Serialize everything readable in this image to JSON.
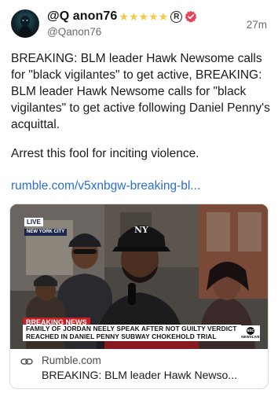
{
  "header": {
    "display_name": "@Q anon76",
    "star_count": 5,
    "handle": "@Qanon76",
    "time_ago": "27m"
  },
  "post": {
    "text_line_block": "BREAKING: BLM leader Hawk Newsome calls for \"black vigilantes\" to get active, BREAKING: BLM leader Hawk Newsome calls for \"black vigilantes\" to get active following Daniel Penny's acquittal.",
    "second_paragraph": "Arrest this fool for inciting violence.",
    "link_text": "rumble.com/v5xnbgw-breaking-bl..."
  },
  "card": {
    "domain": "Rumble.com",
    "title": "BREAKING: BLM leader Hawk Newso...",
    "thumbnail": {
      "live_label": "LIVE",
      "live_city": "NEW YORK CITY",
      "breaking_label": "BREAKING NEWS",
      "lower_third": "FAMILY OF JORDAN NEELY SPEAK AFTER NOT GUILTY VERDICT REACHED IN DANIEL PENNY SUBWAY CHOKEHOLD TRIAL",
      "network_tag": "NEWSLIVE",
      "network_mark": "abc"
    }
  },
  "colors": {
    "link": "#2a6fc9",
    "star": "#f2c94c",
    "verified": "#e8435a",
    "breaking": "#c81f25"
  },
  "icons": {
    "verified": "verified-badge-icon",
    "registered": "registered-mark-icon",
    "star": "star-icon",
    "link": "link-chain-icon"
  }
}
